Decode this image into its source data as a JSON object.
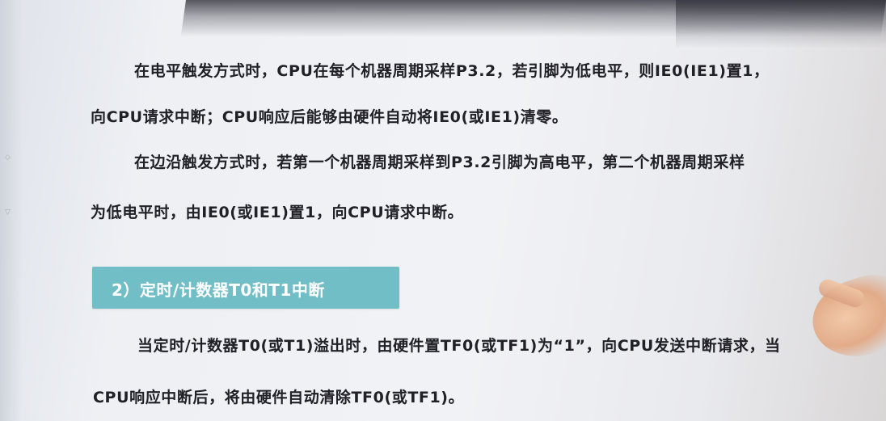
{
  "paragraphs": {
    "p1_line1": "在电平触发方式时，CPU在每个机器周期采样P3.2，若引脚为低电平，则IE0(IE1)置1，",
    "p1_line2": "向CPU请求中断；CPU响应后能够由硬件自动将IE0(或IE1)清零。",
    "p2_line1": "在边沿触发方式时，若第一个机器周期采样到P3.2引脚为高电平，第二个机器周期采样",
    "p2_line2": "为低电平时，由IE0(或IE1)置1，向CPU请求中断。",
    "p3_line1": "当定时/计数器T0(或T1)溢出时，由硬件置TF0(或TF1)为“1”，向CPU发送中断请求，当",
    "p3_line2": "CPU响应中断后，将由硬件自动清除TF0(或TF1)。"
  },
  "section": {
    "title": "2）定时/计数器T0和T1中断",
    "color": "#72bec6"
  }
}
